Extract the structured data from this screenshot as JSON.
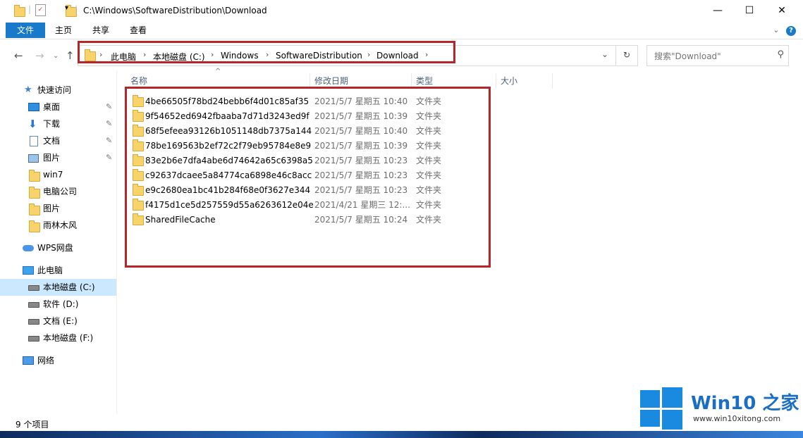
{
  "window": {
    "title_path": "C:\\Windows\\SoftwareDistribution\\Download",
    "controls": {
      "minimize": "—",
      "maximize": "☐",
      "close": "✕"
    }
  },
  "ribbon": {
    "tabs": [
      "文件",
      "主页",
      "共享",
      "查看"
    ],
    "help": "?"
  },
  "navigation": {
    "back": "←",
    "forward": "→",
    "up": "↑",
    "breadcrumb": [
      "此电脑",
      "本地磁盘 (C:)",
      "Windows",
      "SoftwareDistribution",
      "Download"
    ],
    "separator": "›",
    "refresh": "↻",
    "search_placeholder": "搜索\"Download\""
  },
  "sidebar": {
    "quick_access": "快速访问",
    "items": [
      {
        "label": "桌面",
        "icon": "desktop-icon",
        "pinned": true
      },
      {
        "label": "下载",
        "icon": "download-icon",
        "pinned": true
      },
      {
        "label": "文档",
        "icon": "document-icon",
        "pinned": true
      },
      {
        "label": "图片",
        "icon": "picture-icon",
        "pinned": true
      },
      {
        "label": "win7",
        "icon": "folder-icon",
        "pinned": false
      },
      {
        "label": "电脑公司",
        "icon": "folder-icon",
        "pinned": false
      },
      {
        "label": "图片",
        "icon": "folder-icon",
        "pinned": false
      },
      {
        "label": "雨林木风",
        "icon": "folder-icon",
        "pinned": false
      }
    ],
    "wps": "WPS网盘",
    "this_pc": "此电脑",
    "drives": [
      "本地磁盘 (C:)",
      "软件 (D:)",
      "文档 (E:)",
      "本地磁盘 (F:)"
    ],
    "selected_drive": "本地磁盘 (C:)",
    "network": "网络"
  },
  "columns": [
    "名称",
    "修改日期",
    "类型",
    "大小"
  ],
  "files": [
    {
      "name": "4be66505f78bd24bebb6f4d01c85af35",
      "date": "2021/5/7 星期五 10:40",
      "type": "文件夹"
    },
    {
      "name": "9f54652ed6942fbaaba7d71d3243ed9f",
      "date": "2021/5/7 星期五 10:39",
      "type": "文件夹"
    },
    {
      "name": "68f5efeea93126b1051148db7375a144",
      "date": "2021/5/7 星期五 10:40",
      "type": "文件夹"
    },
    {
      "name": "78be169563b2ef72c2f79eb95784e8e9",
      "date": "2021/5/7 星期五 10:39",
      "type": "文件夹"
    },
    {
      "name": "83e2b6e7dfa4abe6d74642a65c6398a5",
      "date": "2021/5/7 星期五 10:23",
      "type": "文件夹"
    },
    {
      "name": "c92637dcaee5a84774ca6898e46c8acc",
      "date": "2021/5/7 星期五 10:23",
      "type": "文件夹"
    },
    {
      "name": "e9c2680ea1bc41b284f68e0f3627e344",
      "date": "2021/5/7 星期五 10:23",
      "type": "文件夹"
    },
    {
      "name": "f4175d1ce5d257559d55a6263612e04e",
      "date": "2021/4/21 星期三 12:...",
      "type": "文件夹"
    },
    {
      "name": "SharedFileCache",
      "date": "2021/5/7 星期五 10:24",
      "type": "文件夹"
    }
  ],
  "status": "9 个项目",
  "watermark": {
    "title": "Win10 之家",
    "url": "www.win10xitong.com"
  },
  "colors": {
    "accent": "#1979ca",
    "highlight": "#b3262b",
    "selection": "#cce8ff",
    "folder": "#f7d36b"
  }
}
